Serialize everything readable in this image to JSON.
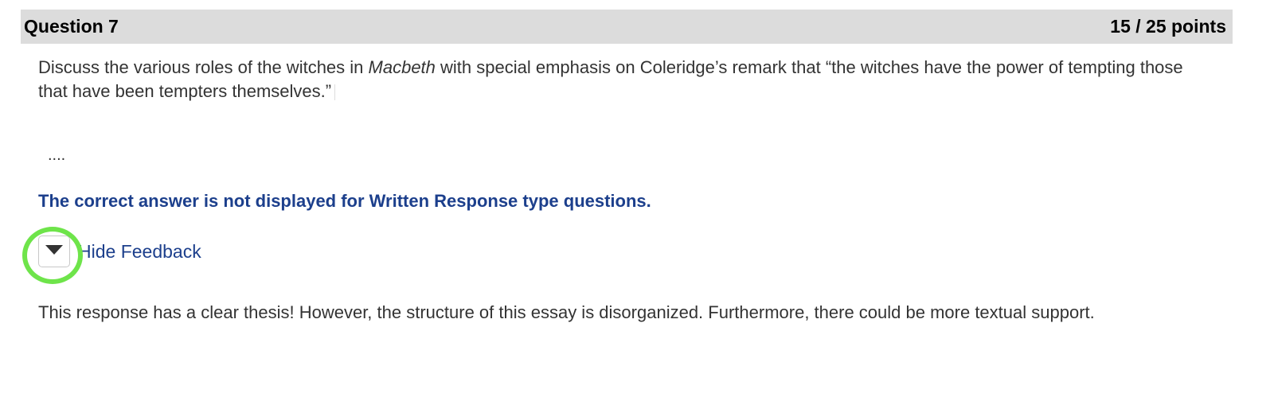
{
  "question": {
    "title": "Question 7",
    "points": "15 / 25 points"
  },
  "prompt": {
    "text_before": "Discuss the various roles of the witches in ",
    "italic": "Macbeth",
    "text_after": " with special emphasis on Coleridge’s remark that “the witches have the power of tempting those that have been tempters themselves.”"
  },
  "response": {
    "text": "...."
  },
  "correct_answer_note": "The correct answer is not displayed for Written Response type questions.",
  "feedback": {
    "toggle_label": "Hide Feedback",
    "toggle_icon": "caret-down-icon",
    "text": "This response has a clear thesis! However, the structure of this essay is disorganized. Furthermore, there could be more textual support."
  },
  "colors": {
    "header_bg": "#dcdcdc",
    "link_blue": "#1c3f8c",
    "highlight_green": "#6ee44a"
  }
}
